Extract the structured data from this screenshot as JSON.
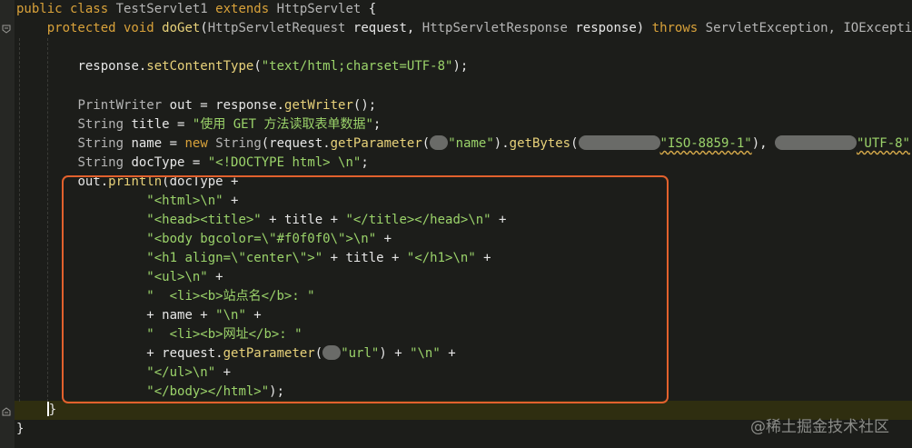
{
  "editor": {
    "watermark": "@稀土掘金技术社区",
    "lines": [
      {
        "id": "l1",
        "indent": "",
        "tokens": [
          [
            "kw",
            "public class "
          ],
          [
            "cls",
            "TestServlet1 "
          ],
          [
            "kw",
            "extends "
          ],
          [
            "cls",
            "HttpServlet "
          ],
          [
            "var",
            "{"
          ]
        ]
      },
      {
        "id": "l2",
        "indent": "    ",
        "tokens": [
          [
            "kw",
            "protected void "
          ],
          [
            "meth",
            "doGet"
          ],
          [
            "var",
            "("
          ],
          [
            "cls",
            "HttpServletRequest "
          ],
          [
            "var",
            "request, "
          ],
          [
            "cls",
            "HttpServletResponse "
          ],
          [
            "var",
            "response) "
          ],
          [
            "kw",
            "throws "
          ],
          [
            "cls",
            "ServletException, IOException "
          ],
          [
            "var",
            "{"
          ]
        ]
      },
      {
        "id": "l3",
        "indent": "",
        "tokens": []
      },
      {
        "id": "l4",
        "indent": "        ",
        "tokens": [
          [
            "var",
            "response."
          ],
          [
            "meth",
            "setContentType"
          ],
          [
            "var",
            "("
          ],
          [
            "str",
            "\"text/html;charset=UTF-8\""
          ],
          [
            "var",
            ");"
          ]
        ]
      },
      {
        "id": "l5",
        "indent": "",
        "tokens": []
      },
      {
        "id": "l6",
        "indent": "        ",
        "tokens": [
          [
            "cls",
            "PrintWriter "
          ],
          [
            "var",
            "out = response."
          ],
          [
            "meth",
            "getWriter"
          ],
          [
            "var",
            "();"
          ]
        ]
      },
      {
        "id": "l7",
        "indent": "        ",
        "tokens": [
          [
            "cls",
            "String "
          ],
          [
            "var",
            "title = "
          ],
          [
            "str",
            "\"使用 GET 方法读取表单数据\""
          ],
          [
            "var",
            ";"
          ]
        ]
      },
      {
        "id": "l8",
        "indent": "        ",
        "tokens": [
          [
            "cls",
            "String "
          ],
          [
            "var",
            "name = "
          ],
          [
            "kw",
            "new "
          ],
          [
            "cls",
            "String"
          ],
          [
            "var",
            "(request."
          ],
          [
            "meth",
            "getParameter"
          ],
          [
            "var",
            "("
          ],
          [
            "blur",
            "small"
          ],
          [
            "str",
            "\"name\""
          ],
          [
            "var",
            ")."
          ],
          [
            "meth",
            "getBytes"
          ],
          [
            "var",
            "("
          ],
          [
            "blur",
            "wide1"
          ],
          [
            "strsq",
            "\"ISO-8859-1\""
          ],
          [
            "var",
            "), "
          ],
          [
            "blur",
            "wide2"
          ],
          [
            "strsq",
            "\"UTF-8\""
          ],
          [
            "var",
            ");"
          ]
        ]
      },
      {
        "id": "l9",
        "indent": "        ",
        "tokens": [
          [
            "cls",
            "String "
          ],
          [
            "var",
            "docType = "
          ],
          [
            "str",
            "\"<!DOCTYPE html> \\n\""
          ],
          [
            "var",
            ";"
          ]
        ]
      },
      {
        "id": "l10",
        "indent": "        ",
        "tokens": [
          [
            "var",
            "out."
          ],
          [
            "meth",
            "println"
          ],
          [
            "var",
            "(docType +"
          ]
        ]
      },
      {
        "id": "l11",
        "indent": "                 ",
        "tokens": [
          [
            "str",
            "\"<html>\\n\""
          ],
          [
            "var",
            " +"
          ]
        ]
      },
      {
        "id": "l12",
        "indent": "                 ",
        "tokens": [
          [
            "str",
            "\"<head><title>\""
          ],
          [
            "var",
            " + title + "
          ],
          [
            "str",
            "\"</title></head>\\n\""
          ],
          [
            "var",
            " +"
          ]
        ]
      },
      {
        "id": "l13",
        "indent": "                 ",
        "tokens": [
          [
            "str",
            "\"<body bgcolor=\\\"#f0f0f0\\\">\\n\""
          ],
          [
            "var",
            " +"
          ]
        ]
      },
      {
        "id": "l14",
        "indent": "                 ",
        "tokens": [
          [
            "str",
            "\"<h1 align=\\\"center\\\">\""
          ],
          [
            "var",
            " + title + "
          ],
          [
            "str",
            "\"</h1>\\n\""
          ],
          [
            "var",
            " +"
          ]
        ]
      },
      {
        "id": "l15",
        "indent": "                 ",
        "tokens": [
          [
            "str",
            "\"<ul>\\n\""
          ],
          [
            "var",
            " +"
          ]
        ]
      },
      {
        "id": "l16",
        "indent": "                 ",
        "tokens": [
          [
            "str",
            "\"  <li><b>站点名</b>: \""
          ]
        ]
      },
      {
        "id": "l17",
        "indent": "                 ",
        "tokens": [
          [
            "var",
            "+ name + "
          ],
          [
            "str",
            "\"\\n\""
          ],
          [
            "var",
            " +"
          ]
        ]
      },
      {
        "id": "l18",
        "indent": "                 ",
        "tokens": [
          [
            "str",
            "\"  <li><b>网址</b>: \""
          ]
        ]
      },
      {
        "id": "l19",
        "indent": "                 ",
        "tokens": [
          [
            "var",
            "+ request."
          ],
          [
            "meth",
            "getParameter"
          ],
          [
            "var",
            "("
          ],
          [
            "blur",
            "small"
          ],
          [
            "str",
            "\"url\""
          ],
          [
            "var",
            ") + "
          ],
          [
            "str",
            "\"\\n\""
          ],
          [
            "var",
            " +"
          ]
        ]
      },
      {
        "id": "l20",
        "indent": "                 ",
        "tokens": [
          [
            "str",
            "\"</ul>\\n\""
          ],
          [
            "var",
            " +"
          ]
        ]
      },
      {
        "id": "l21",
        "indent": "                 ",
        "tokens": [
          [
            "str",
            "\"</body></html>\""
          ],
          [
            "var",
            ");"
          ]
        ]
      },
      {
        "id": "l22",
        "indent": "    ",
        "tokens": [
          [
            "caret",
            ""
          ]
        ]
      },
      {
        "id": "l23",
        "indent": "",
        "tokens": [
          [
            "var",
            "}"
          ]
        ]
      }
    ]
  }
}
